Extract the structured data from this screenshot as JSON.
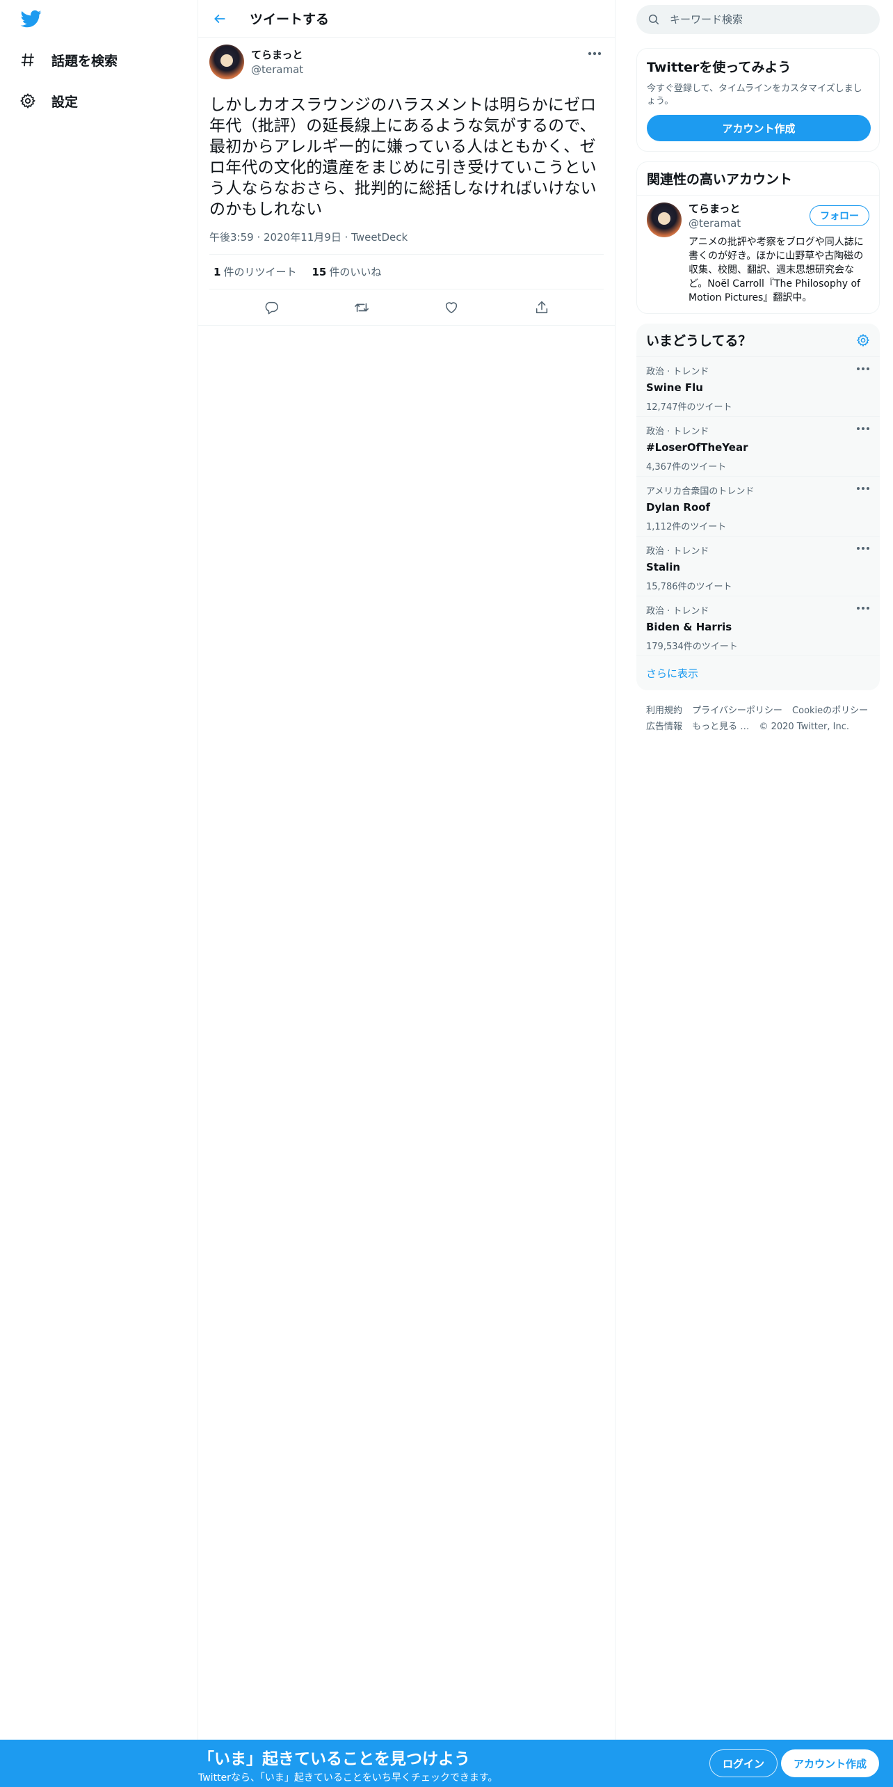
{
  "colors": {
    "accent": "#1d9bf0",
    "text": "#0f1419",
    "secondary_text": "#536471",
    "border": "#eff3f4"
  },
  "nav": {
    "logo_icon": "twitter-bird-icon",
    "items": [
      {
        "label": "話題を検索",
        "icon": "hashtag-icon"
      },
      {
        "label": "設定",
        "icon": "gear-icon"
      }
    ]
  },
  "header": {
    "title": "ツイートする",
    "back_icon": "arrow-left-icon"
  },
  "tweet": {
    "author_name": "てらまっと",
    "author_handle": "@teramat",
    "text": "しかしカオスラウンジのハラスメントは明らかにゼロ年代（批評）の延長線上にあるような気がするので、最初からアレルギー的に嫌っている人はともかく、ゼロ年代の文化的遺産をまじめに引き受けていこうという人ならなおさら、批判的に総括しなければいけないのかもしれない",
    "time": "午後3:59",
    "date": "2020年11月9日",
    "source": "TweetDeck",
    "retweet_count": "1",
    "retweet_label": "件のリツイート",
    "like_count": "15",
    "like_label": "件のいいね"
  },
  "search": {
    "placeholder": "キーワード検索"
  },
  "signup_card": {
    "title": "Twitterを使ってみよう",
    "description": "今すぐ登録して、タイムラインをカスタマイズしましょう。",
    "button": "アカウント作成"
  },
  "related": {
    "title": "関連性の高いアカウント",
    "name": "てらまっと",
    "handle": "@teramat",
    "follow_button": "フォロー",
    "bio": "アニメの批評や考察をブログや同人誌に書くのが好き。ほかに山野草や古陶磁の収集、校閲、翻訳、週末思想研究会など。Noël Carroll『The Philosophy of Motion Pictures』翻訳中。"
  },
  "trends": {
    "title": "いまどうしてる？",
    "items": [
      {
        "context": "政治 · トレンド",
        "name": "Swine Flu",
        "count": "12,747件のツイート"
      },
      {
        "context": "政治 · トレンド",
        "name": "#LoserOfTheYear",
        "count": "4,367件のツイート"
      },
      {
        "context": "アメリカ合衆国のトレンド",
        "name": "Dylan Roof",
        "count": "1,112件のツイート"
      },
      {
        "context": "政治 · トレンド",
        "name": "Stalin",
        "count": "15,786件のツイート"
      },
      {
        "context": "政治 · トレンド",
        "name": "Biden & Harris",
        "count": "179,534件のツイート"
      }
    ],
    "show_more": "さらに表示"
  },
  "footer": {
    "links": [
      "利用規約",
      "プライバシーポリシー",
      "Cookieのポリシー",
      "広告情報",
      "もっと見る …"
    ],
    "copyright": "© 2020 Twitter, Inc."
  },
  "bottom_bar": {
    "title": "「いま」起きていることを見つけよう",
    "subtitle": "Twitterなら、「いま」起きていることをいち早くチェックできます。",
    "login": "ログイン",
    "signup": "アカウント作成"
  }
}
